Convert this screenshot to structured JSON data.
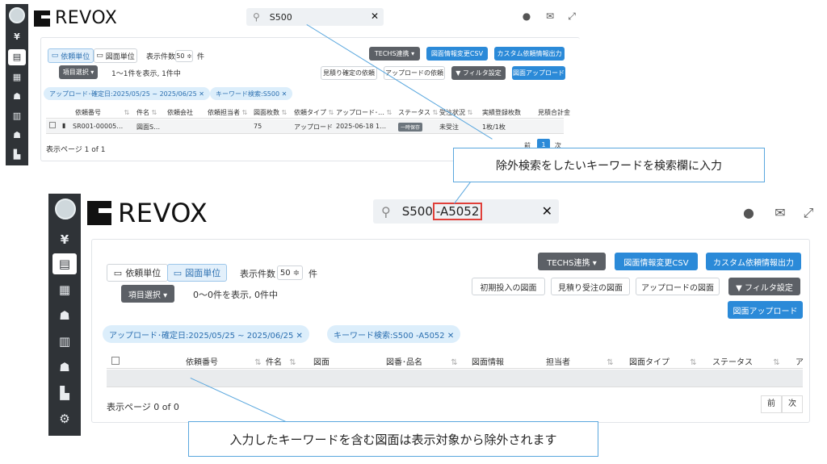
{
  "brand": "REVOX",
  "top": {
    "search_value": "S500",
    "toggle_request": "依頼単位",
    "toggle_drawing": "図面単位",
    "per_page_label": "表示件数",
    "per_page_value": "50 ≑",
    "per_page_unit": "件",
    "item_select": "項目選択 ▾",
    "result_text": "1〜1件を表示, 1件中",
    "btn_techs": "TECHS連携 ▾",
    "btn_csv": "図面情報変更CSV",
    "btn_custom": "カスタム依頼情報出力",
    "btn_estimate": "見積り確定の依頼",
    "btn_upload_req": "アップロードの依頼",
    "btn_filter": "▼ フィルタ設定",
    "btn_upload": "図面アップロード",
    "chip_date": "アップロード･確定日:2025/05/25 ~ 2025/06/25 ✕",
    "chip_keyword": "キーワード検索:S500 ✕",
    "columns": [
      "依頼番号",
      "件名",
      "依頼会社",
      "依頼担当者",
      "図面枚数",
      "依頼タイプ",
      "アップロード･…",
      "ステータス",
      "受注状況",
      "実績登録枚数",
      "見積合計金"
    ],
    "row": {
      "no": "SR001-00005…",
      "title": "図面S…",
      "count": "75",
      "type": "アップロード",
      "date": "2025-06-18 1…",
      "status": "一時保存",
      "order": "未受注",
      "registered": "1枚/1枚"
    },
    "footer_page": "表示ページ 1 of 1",
    "pager_prev": "前",
    "pager_current": "1",
    "pager_next": "次"
  },
  "bottom": {
    "search_value": "S500",
    "search_highlight": "-A5052",
    "toggle_request": "依頼単位",
    "toggle_drawing": "図面単位",
    "per_page_label": "表示件数",
    "per_page_value": "50 ≑",
    "per_page_unit": "件",
    "item_select": "項目選択 ▾",
    "result_text": "0〜0件を表示, 0件中",
    "btn_techs": "TECHS連携 ▾",
    "btn_csv": "図面情報変更CSV",
    "btn_custom": "カスタム依頼情報出力",
    "btn_initial": "初期投入の図面",
    "btn_estimate": "見積り受注の図面",
    "btn_upload_dr": "アップロードの図面",
    "btn_filter": "▼ フィルタ設定",
    "btn_upload": "図面アップロード",
    "chip_date": "アップロード･確定日:2025/05/25 ~ 2025/06/25 ✕",
    "chip_keyword": "キーワード検索:S500 -A5052 ✕",
    "columns": [
      "依頼番号",
      "件名",
      "図面",
      "図番･品名",
      "図面情報",
      "担当者",
      "図面タイプ",
      "ステータス",
      "ア"
    ],
    "footer_page": "表示ページ 0 of 0",
    "pager_prev": "前",
    "pager_next": "次"
  },
  "callouts": {
    "top": "除外検索をしたいキーワードを検索欄に入力",
    "bottom": "入力したキーワードを含む図面は表示対象から除外されます"
  },
  "icons": {
    "sidebar": [
      "yen-icon",
      "search-doc-icon",
      "building-add-icon",
      "user-add-icon",
      "building-icon",
      "user-icon",
      "factory-icon",
      "users-settings-icon"
    ],
    "header": [
      "account-icon",
      "mail-icon",
      "expand-icon"
    ]
  },
  "colors": {
    "sidebar": "#2f3337",
    "accent": "#2b8ad8",
    "chip": "#dceefb",
    "highlight": "#e0403a",
    "callout_border": "#5aa7de"
  }
}
